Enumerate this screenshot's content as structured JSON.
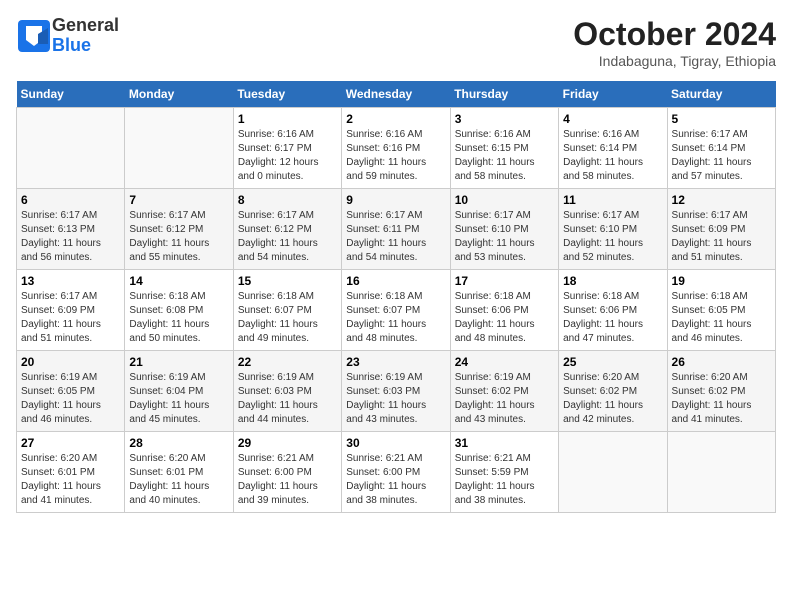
{
  "logo": {
    "line1": "General",
    "line2": "Blue"
  },
  "title": "October 2024",
  "subtitle": "Indabaguna, Tigray, Ethiopia",
  "days_of_week": [
    "Sunday",
    "Monday",
    "Tuesday",
    "Wednesday",
    "Thursday",
    "Friday",
    "Saturday"
  ],
  "weeks": [
    [
      {
        "day": "",
        "info": ""
      },
      {
        "day": "",
        "info": ""
      },
      {
        "day": "1",
        "info": "Sunrise: 6:16 AM\nSunset: 6:17 PM\nDaylight: 12 hours\nand 0 minutes."
      },
      {
        "day": "2",
        "info": "Sunrise: 6:16 AM\nSunset: 6:16 PM\nDaylight: 11 hours\nand 59 minutes."
      },
      {
        "day": "3",
        "info": "Sunrise: 6:16 AM\nSunset: 6:15 PM\nDaylight: 11 hours\nand 58 minutes."
      },
      {
        "day": "4",
        "info": "Sunrise: 6:16 AM\nSunset: 6:14 PM\nDaylight: 11 hours\nand 58 minutes."
      },
      {
        "day": "5",
        "info": "Sunrise: 6:17 AM\nSunset: 6:14 PM\nDaylight: 11 hours\nand 57 minutes."
      }
    ],
    [
      {
        "day": "6",
        "info": "Sunrise: 6:17 AM\nSunset: 6:13 PM\nDaylight: 11 hours\nand 56 minutes."
      },
      {
        "day": "7",
        "info": "Sunrise: 6:17 AM\nSunset: 6:12 PM\nDaylight: 11 hours\nand 55 minutes."
      },
      {
        "day": "8",
        "info": "Sunrise: 6:17 AM\nSunset: 6:12 PM\nDaylight: 11 hours\nand 54 minutes."
      },
      {
        "day": "9",
        "info": "Sunrise: 6:17 AM\nSunset: 6:11 PM\nDaylight: 11 hours\nand 54 minutes."
      },
      {
        "day": "10",
        "info": "Sunrise: 6:17 AM\nSunset: 6:10 PM\nDaylight: 11 hours\nand 53 minutes."
      },
      {
        "day": "11",
        "info": "Sunrise: 6:17 AM\nSunset: 6:10 PM\nDaylight: 11 hours\nand 52 minutes."
      },
      {
        "day": "12",
        "info": "Sunrise: 6:17 AM\nSunset: 6:09 PM\nDaylight: 11 hours\nand 51 minutes."
      }
    ],
    [
      {
        "day": "13",
        "info": "Sunrise: 6:17 AM\nSunset: 6:09 PM\nDaylight: 11 hours\nand 51 minutes."
      },
      {
        "day": "14",
        "info": "Sunrise: 6:18 AM\nSunset: 6:08 PM\nDaylight: 11 hours\nand 50 minutes."
      },
      {
        "day": "15",
        "info": "Sunrise: 6:18 AM\nSunset: 6:07 PM\nDaylight: 11 hours\nand 49 minutes."
      },
      {
        "day": "16",
        "info": "Sunrise: 6:18 AM\nSunset: 6:07 PM\nDaylight: 11 hours\nand 48 minutes."
      },
      {
        "day": "17",
        "info": "Sunrise: 6:18 AM\nSunset: 6:06 PM\nDaylight: 11 hours\nand 48 minutes."
      },
      {
        "day": "18",
        "info": "Sunrise: 6:18 AM\nSunset: 6:06 PM\nDaylight: 11 hours\nand 47 minutes."
      },
      {
        "day": "19",
        "info": "Sunrise: 6:18 AM\nSunset: 6:05 PM\nDaylight: 11 hours\nand 46 minutes."
      }
    ],
    [
      {
        "day": "20",
        "info": "Sunrise: 6:19 AM\nSunset: 6:05 PM\nDaylight: 11 hours\nand 46 minutes."
      },
      {
        "day": "21",
        "info": "Sunrise: 6:19 AM\nSunset: 6:04 PM\nDaylight: 11 hours\nand 45 minutes."
      },
      {
        "day": "22",
        "info": "Sunrise: 6:19 AM\nSunset: 6:03 PM\nDaylight: 11 hours\nand 44 minutes."
      },
      {
        "day": "23",
        "info": "Sunrise: 6:19 AM\nSunset: 6:03 PM\nDaylight: 11 hours\nand 43 minutes."
      },
      {
        "day": "24",
        "info": "Sunrise: 6:19 AM\nSunset: 6:02 PM\nDaylight: 11 hours\nand 43 minutes."
      },
      {
        "day": "25",
        "info": "Sunrise: 6:20 AM\nSunset: 6:02 PM\nDaylight: 11 hours\nand 42 minutes."
      },
      {
        "day": "26",
        "info": "Sunrise: 6:20 AM\nSunset: 6:02 PM\nDaylight: 11 hours\nand 41 minutes."
      }
    ],
    [
      {
        "day": "27",
        "info": "Sunrise: 6:20 AM\nSunset: 6:01 PM\nDaylight: 11 hours\nand 41 minutes."
      },
      {
        "day": "28",
        "info": "Sunrise: 6:20 AM\nSunset: 6:01 PM\nDaylight: 11 hours\nand 40 minutes."
      },
      {
        "day": "29",
        "info": "Sunrise: 6:21 AM\nSunset: 6:00 PM\nDaylight: 11 hours\nand 39 minutes."
      },
      {
        "day": "30",
        "info": "Sunrise: 6:21 AM\nSunset: 6:00 PM\nDaylight: 11 hours\nand 38 minutes."
      },
      {
        "day": "31",
        "info": "Sunrise: 6:21 AM\nSunset: 5:59 PM\nDaylight: 11 hours\nand 38 minutes."
      },
      {
        "day": "",
        "info": ""
      },
      {
        "day": "",
        "info": ""
      }
    ]
  ]
}
